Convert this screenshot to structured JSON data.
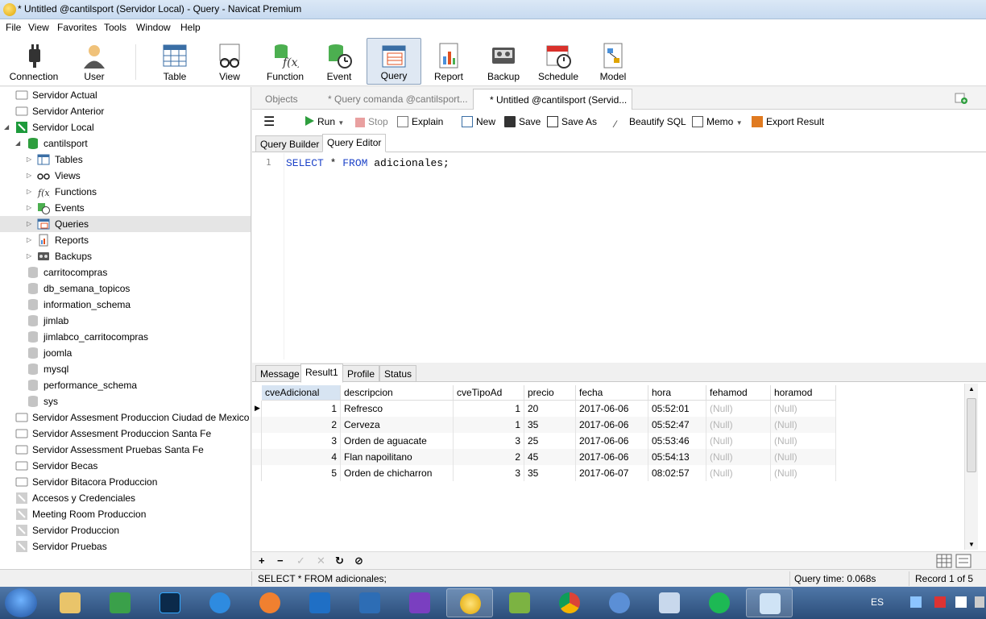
{
  "window": {
    "title": "* Untitled @cantilsport (Servidor Local) - Query - Navicat Premium"
  },
  "menu": [
    "File",
    "View",
    "Favorites",
    "Tools",
    "Window",
    "Help"
  ],
  "toolbar": [
    "Connection",
    "User",
    "Table",
    "View",
    "Function",
    "Event",
    "Query",
    "Report",
    "Backup",
    "Schedule",
    "Model"
  ],
  "sidebar": {
    "servers_top": [
      "Servidor Actual",
      "Servidor Anterior",
      "Servidor Local"
    ],
    "database": "cantilsport",
    "children": [
      "Tables",
      "Views",
      "Functions",
      "Events",
      "Queries",
      "Reports",
      "Backups"
    ],
    "databases": [
      "carritocompras",
      "db_semana_topicos",
      "information_schema",
      "jimlab",
      "jimlabco_carritocompras",
      "joomla",
      "mysql",
      "performance_schema",
      "sys"
    ],
    "servers_bottom": [
      "Servidor Assesment Produccion Ciudad de Mexico",
      "Servidor Assesment Produccion Santa Fe",
      "Servidor Assessment Pruebas Santa Fe",
      "Servidor Becas",
      "Servidor Bitacora Produccion",
      "Accesos y Credenciales",
      "Meeting Room Produccion",
      "Servidor Produccion",
      "Servidor Pruebas"
    ]
  },
  "object_tabs": [
    "Objects",
    "* Query comanda @cantilsport...",
    "* Untitled @cantilsport (Servid..."
  ],
  "query_toolbar": {
    "run": "Run",
    "stop": "Stop",
    "explain": "Explain",
    "new": "New",
    "save": "Save",
    "save_as": "Save As",
    "beautify": "Beautify SQL",
    "memo": "Memo",
    "export": "Export Result"
  },
  "query_tabs": [
    "Query Builder",
    "Query Editor"
  ],
  "editor": {
    "line": "1",
    "kw1": "SELECT",
    "star": " * ",
    "kw2": "FROM",
    "rest": " adicionales;"
  },
  "result_tabs": [
    "Message",
    "Result1",
    "Profile",
    "Status"
  ],
  "grid": {
    "columns": [
      "cveAdicional",
      "descripcion",
      "cveTipoAd",
      "precio",
      "fecha",
      "hora",
      "fehamod",
      "horamod"
    ],
    "rows": [
      [
        "1",
        "Refresco",
        "1",
        "20",
        "2017-06-06",
        "05:52:01",
        "(Null)",
        "(Null)"
      ],
      [
        "2",
        "Cerveza",
        "1",
        "35",
        "2017-06-06",
        "05:52:47",
        "(Null)",
        "(Null)"
      ],
      [
        "3",
        "Orden de aguacate",
        "3",
        "25",
        "2017-06-06",
        "05:53:46",
        "(Null)",
        "(Null)"
      ],
      [
        "4",
        "Flan napoilitano",
        "2",
        "45",
        "2017-06-06",
        "05:54:13",
        "(Null)",
        "(Null)"
      ],
      [
        "5",
        "Orden de chicharron",
        "3",
        "35",
        "2017-06-07",
        "08:02:57",
        "(Null)",
        "(Null)"
      ]
    ]
  },
  "status": {
    "sql": "SELECT * FROM adicionales;",
    "time": "Query time: 0.068s",
    "record": "Record 1 of 5"
  },
  "tray": {
    "lang": "ES"
  }
}
